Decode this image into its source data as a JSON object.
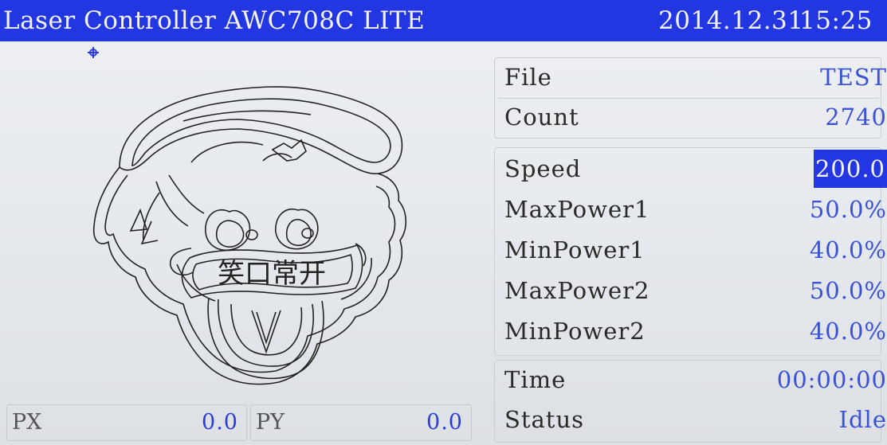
{
  "header": {
    "title": "Laser Controller AWC708C LITE",
    "date": "2014.12.31",
    "time": "15:25"
  },
  "preview": {
    "design_text": "笑口常开",
    "origin_marker": "crosshair-icon"
  },
  "position": {
    "px_label": "PX",
    "px_value": "0.0",
    "py_label": "PY",
    "py_value": "0.0"
  },
  "file_info": {
    "file_label": "File",
    "file_value": "TEST",
    "count_label": "Count",
    "count_value": "2740"
  },
  "params": [
    {
      "label": "Speed",
      "value": "200.0",
      "selected": true
    },
    {
      "label": "MaxPower1",
      "value": "50.0%"
    },
    {
      "label": "MinPower1",
      "value": "40.0%"
    },
    {
      "label": "MaxPower2",
      "value": "50.0%"
    },
    {
      "label": "MinPower2",
      "value": "40.0%"
    }
  ],
  "status_info": {
    "time_label": "Time",
    "time_value": "00:00:00",
    "status_label": "Status",
    "status_value": "Idle"
  },
  "colors": {
    "header_bg": "#2236e2",
    "value_text": "#3b52d6",
    "screen_bg": "#e6e9ed"
  }
}
